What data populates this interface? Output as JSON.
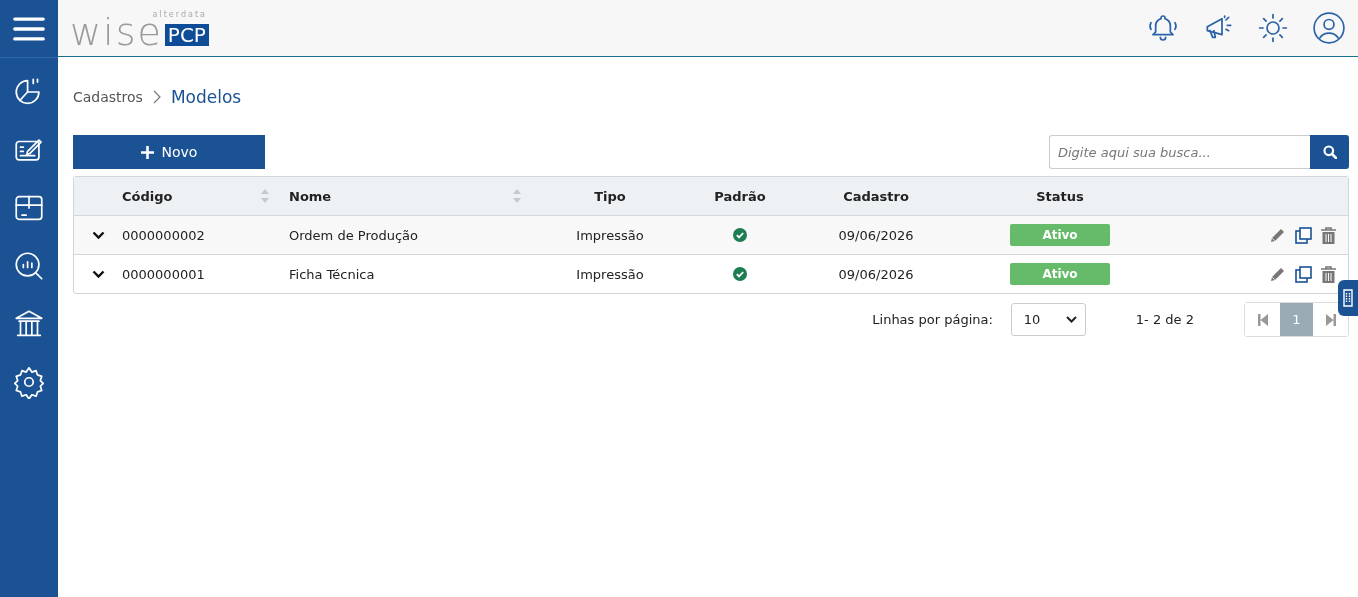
{
  "logo": {
    "vendor": "alterdata",
    "brand": "wise",
    "product": "PCP"
  },
  "breadcrumb": [
    {
      "label": "Cadastros",
      "current": false
    },
    {
      "label": "Modelos",
      "current": true
    }
  ],
  "new_button": {
    "label": "Novo"
  },
  "search": {
    "placeholder": "Digite aqui sua busca..."
  },
  "table": {
    "columns": [
      {
        "label": "Código",
        "sortable": true
      },
      {
        "label": "Nome",
        "sortable": true
      },
      {
        "label": "Tipo",
        "sortable": false
      },
      {
        "label": "Padrão",
        "sortable": false
      },
      {
        "label": "Cadastro",
        "sortable": false
      },
      {
        "label": "Status",
        "sortable": false
      }
    ],
    "rows": [
      {
        "code": "0000000002",
        "name": "Ordem de Produção",
        "type": "Impressão",
        "default": true,
        "created": "09/06/2026",
        "status": "Ativo"
      },
      {
        "code": "0000000001",
        "name": "Ficha Técnica",
        "type": "Impressão",
        "default": true,
        "created": "09/06/2026",
        "status": "Ativo"
      }
    ]
  },
  "pagination": {
    "rows_label": "Linhas por página:",
    "rows_per_page": "10",
    "range": "1- 2 de 2",
    "pages": [
      {
        "label": "1",
        "selected": true
      }
    ]
  }
}
